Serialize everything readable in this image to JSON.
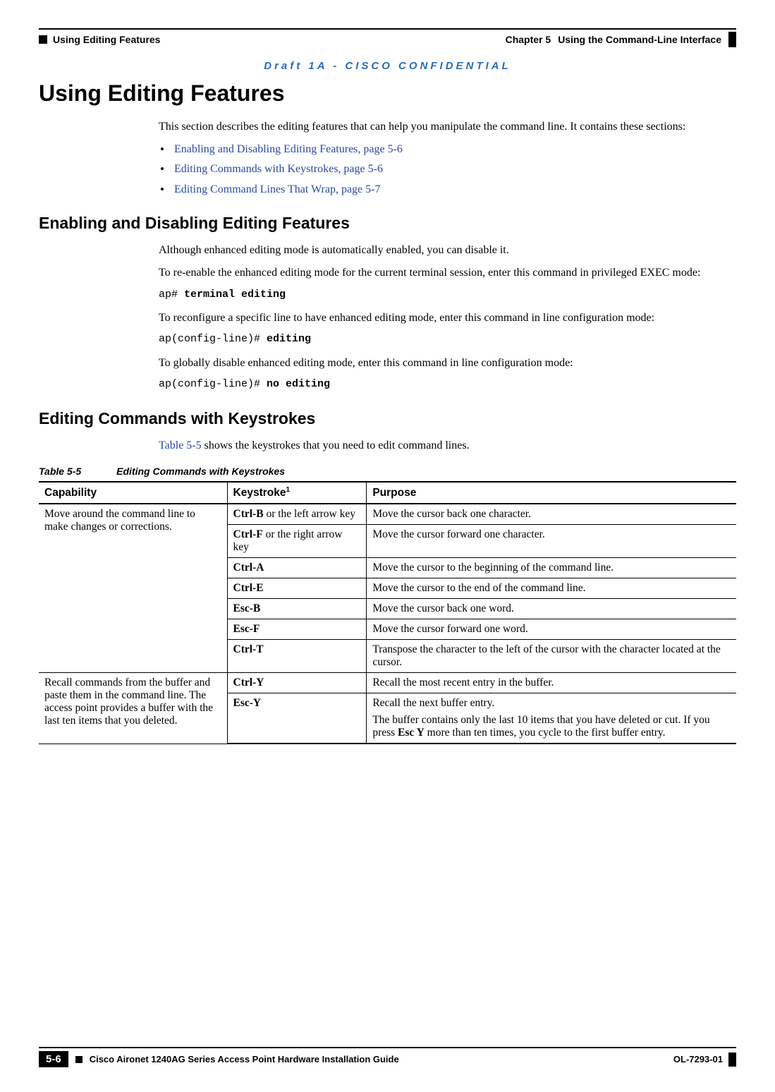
{
  "header": {
    "section": "Using Editing Features",
    "chapterLabel": "Chapter 5",
    "chapterTitle": "Using the Command-Line Interface"
  },
  "draft": "Draft 1A - CISCO CONFIDENTIAL",
  "h1": "Using Editing Features",
  "intro": "This section describes the editing features that can help you manipulate the command line. It contains these sections:",
  "bullets": {
    "b1": "Enabling and Disabling Editing Features, page 5-6",
    "b2": "Editing Commands with Keystrokes, page 5-6",
    "b3": "Editing Command Lines That Wrap, page 5-7"
  },
  "sec1": {
    "title": "Enabling and Disabling Editing Features",
    "p1": "Although enhanced editing mode is automatically enabled, you can disable it.",
    "p2": "To re-enable the enhanced editing mode for the current terminal session, enter this command in privileged EXEC mode:",
    "cmd1a": "ap# ",
    "cmd1b": "terminal editing",
    "p3": "To reconfigure a specific line to have enhanced editing mode, enter this command in line configuration mode:",
    "cmd2a": "ap(config-line)# ",
    "cmd2b": "editing",
    "p4": "To globally disable enhanced editing mode, enter this command in line configuration mode:",
    "cmd3a": "ap(config-line)# ",
    "cmd3b": "no editing"
  },
  "sec2": {
    "title": "Editing Commands with Keystrokes",
    "introPrefix": "Table 5-5",
    "introSuffix": " shows the keystrokes that you need to edit command lines."
  },
  "tableCaption": {
    "label": "Table 5-5",
    "title": "Editing Commands with Keystrokes"
  },
  "table": {
    "headers": {
      "c1": "Capability",
      "c2": "Keystroke",
      "c2sup": "1",
      "c3": "Purpose"
    },
    "group1_cap": "Move around the command line to make changes or corrections.",
    "group2_cap": "Recall commands from the buffer and paste them in the command line. The access point provides a buffer with the last ten items that you deleted.",
    "r1": {
      "k_bold": "Ctrl-B",
      "k_rest": " or the left arrow key",
      "p": "Move the cursor back one character."
    },
    "r2": {
      "k_bold": "Ctrl-F",
      "k_rest": " or the right arrow key",
      "p": "Move the cursor forward one character."
    },
    "r3": {
      "k_bold": "Ctrl-A",
      "p": "Move the cursor to the beginning of the command line."
    },
    "r4": {
      "k_bold": "Ctrl-E",
      "p": "Move the cursor to the end of the command line."
    },
    "r5": {
      "k_bold": "Esc-B",
      "p": "Move the cursor back one word."
    },
    "r6": {
      "k_bold": "Esc-F",
      "p": "Move the cursor forward one word."
    },
    "r7": {
      "k_bold": "Ctrl-T",
      "p": "Transpose the character to the left of the cursor with the character located at the cursor."
    },
    "r8": {
      "k_bold": "Ctrl-Y",
      "p": "Recall the most recent entry in the buffer."
    },
    "r9": {
      "k_bold": "Esc-Y",
      "p1": "Recall the next buffer entry.",
      "p2a": "The buffer contains only the last 10 items that you have deleted or cut. If you press ",
      "p2b": "Esc Y",
      "p2c": " more than ten times, you cycle to the first buffer entry."
    }
  },
  "footer": {
    "guide": "Cisco Aironet 1240AG Series Access Point Hardware Installation Guide",
    "docnum": "OL-7293-01",
    "page": "5-6"
  }
}
